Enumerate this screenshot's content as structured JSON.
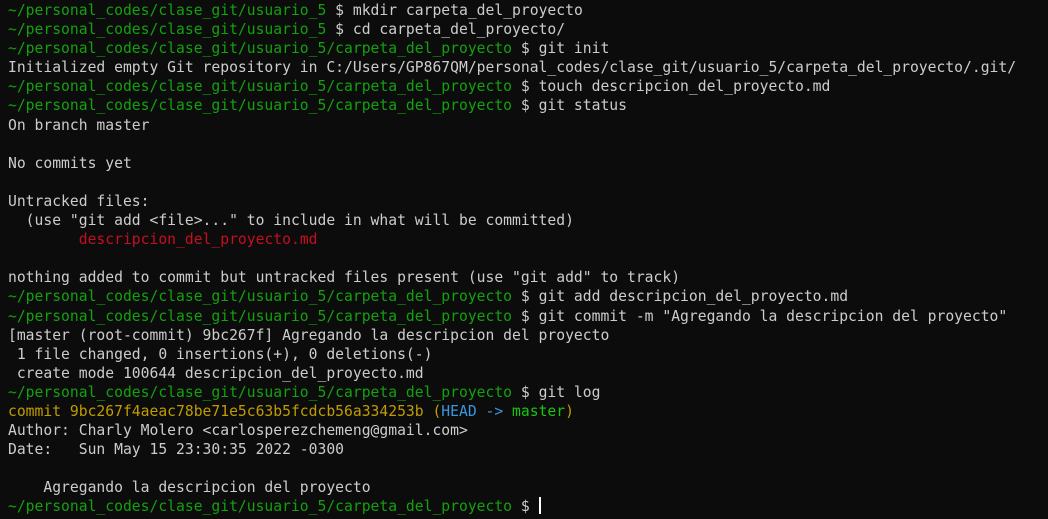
{
  "terminal": {
    "prompt_sep": " $ ",
    "lines": [
      {
        "type": "cmd",
        "path": "~/personal_codes/clase_git/usuario_5",
        "cmd": "mkdir carpeta_del_proyecto"
      },
      {
        "type": "cmd",
        "path": "~/personal_codes/clase_git/usuario_5",
        "cmd": "cd carpeta_del_proyecto/"
      },
      {
        "type": "cmd",
        "path": "~/personal_codes/clase_git/usuario_5/carpeta_del_proyecto",
        "cmd": "git init"
      },
      {
        "type": "out",
        "text": "Initialized empty Git repository in C:/Users/GP867QM/personal_codes/clase_git/usuario_5/carpeta_del_proyecto/.git/"
      },
      {
        "type": "cmd",
        "path": "~/personal_codes/clase_git/usuario_5/carpeta_del_proyecto",
        "cmd": "touch descripcion_del_proyecto.md"
      },
      {
        "type": "cmd",
        "path": "~/personal_codes/clase_git/usuario_5/carpeta_del_proyecto",
        "cmd": "git status"
      },
      {
        "type": "out",
        "text": "On branch master"
      },
      {
        "type": "out",
        "text": ""
      },
      {
        "type": "out",
        "text": "No commits yet"
      },
      {
        "type": "out",
        "text": ""
      },
      {
        "type": "out",
        "text": "Untracked files:"
      },
      {
        "type": "out",
        "text": "  (use \"git add <file>...\" to include in what will be committed)"
      },
      {
        "type": "untracked",
        "indent": "        ",
        "text": "descripcion_del_proyecto.md"
      },
      {
        "type": "out",
        "text": ""
      },
      {
        "type": "out",
        "text": "nothing added to commit but untracked files present (use \"git add\" to track)"
      },
      {
        "type": "cmd",
        "path": "~/personal_codes/clase_git/usuario_5/carpeta_del_proyecto",
        "cmd": "git add descripcion_del_proyecto.md"
      },
      {
        "type": "cmd",
        "path": "~/personal_codes/clase_git/usuario_5/carpeta_del_proyecto",
        "cmd": "git commit -m \"Agregando la descripcion del proyecto\""
      },
      {
        "type": "out",
        "text": "[master (root-commit) 9bc267f] Agregando la descripcion del proyecto"
      },
      {
        "type": "out",
        "text": " 1 file changed, 0 insertions(+), 0 deletions(-)"
      },
      {
        "type": "out",
        "text": " create mode 100644 descripcion_del_proyecto.md"
      },
      {
        "type": "cmd",
        "path": "~/personal_codes/clase_git/usuario_5/carpeta_del_proyecto",
        "cmd": "git log"
      },
      {
        "type": "commit",
        "commit": "commit 9bc267f4aeac78be71e5c63b5fcdcb56a334253b",
        "open": " (",
        "head": "HEAD -> ",
        "branch": "master",
        "close": ")"
      },
      {
        "type": "out",
        "text": "Author: Charly Molero <carlosperezchemeng@gmail.com>"
      },
      {
        "type": "out",
        "text": "Date:   Sun May 15 23:30:35 2022 -0300"
      },
      {
        "type": "out",
        "text": ""
      },
      {
        "type": "out",
        "text": "    Agregando la descripcion del proyecto"
      },
      {
        "type": "prompt",
        "path": "~/personal_codes/clase_git/usuario_5/carpeta_del_proyecto",
        "cmd": ""
      }
    ]
  },
  "colors": {
    "background": "#0c0c0c",
    "text": "#cccccc",
    "prompt_path": "#13a10e",
    "untracked_file": "#c50f1f",
    "commit_hash": "#c19c00",
    "head_ref": "#3a96dd",
    "branch_ref": "#16c60c"
  }
}
